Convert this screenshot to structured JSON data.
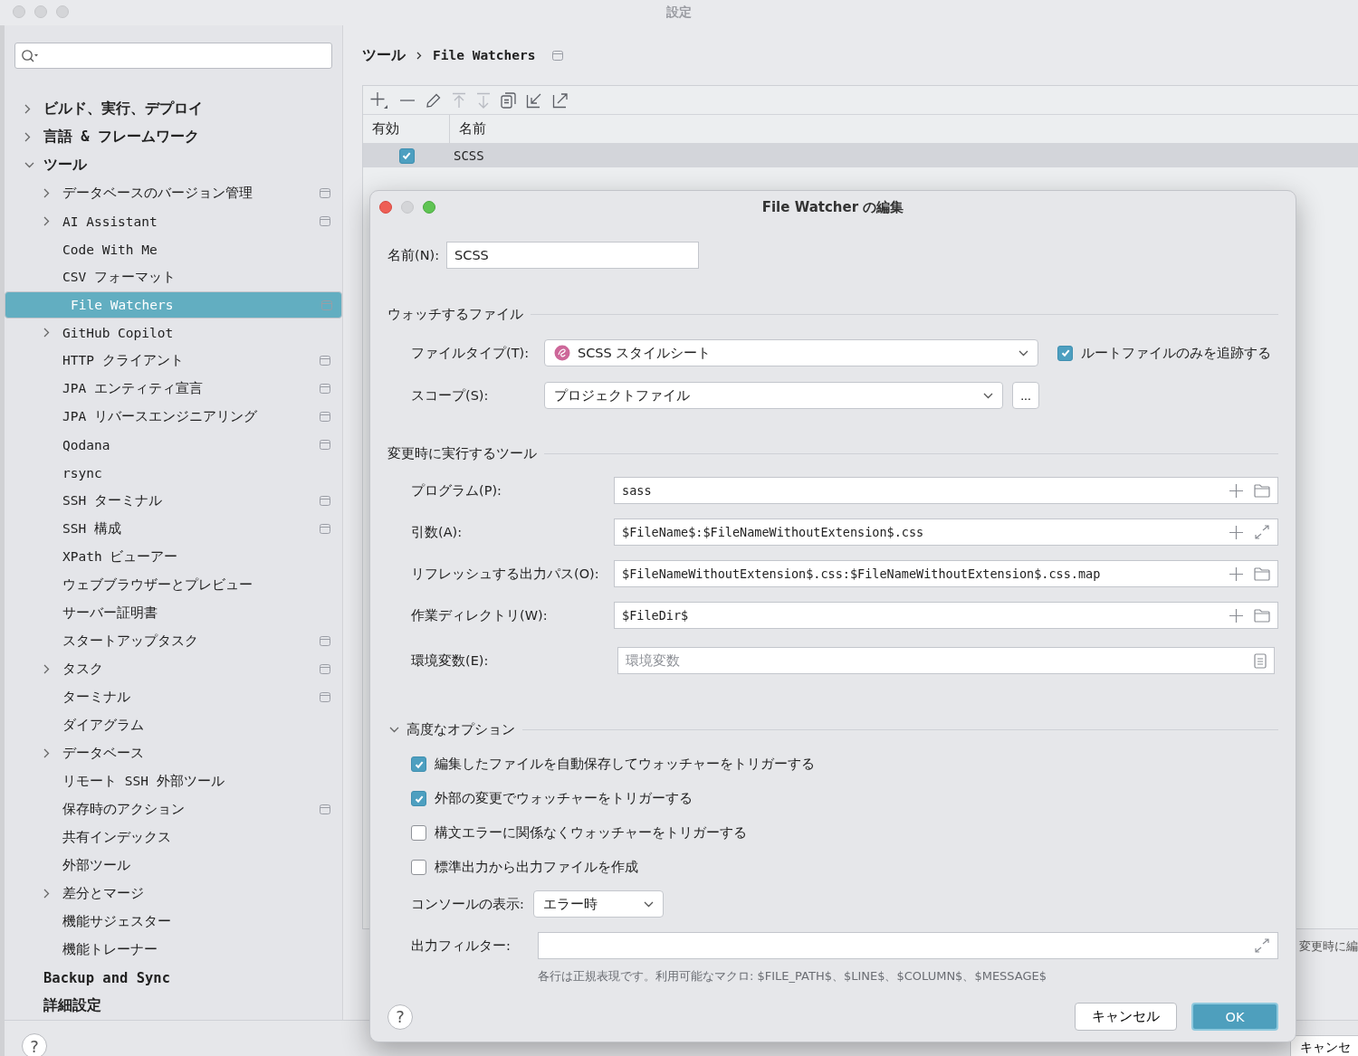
{
  "window": {
    "title": "設定",
    "help_button": "?"
  },
  "sidebar": {
    "items": [
      {
        "label": "ビルド、実行、デプロイ",
        "expanded": false,
        "selected": false
      },
      {
        "label": "言語 & フレームワーク",
        "expanded": false,
        "selected": false
      },
      {
        "label": "ツール",
        "expanded": true,
        "selected": false,
        "children": [
          {
            "label": "データベースのバージョン管理",
            "expanded": false,
            "selected": false,
            "project_level": true
          },
          {
            "label": "AI Assistant",
            "expanded": false,
            "selected": false,
            "project_level": true
          },
          {
            "label": "Code With Me",
            "selected": false,
            "project_level": false
          },
          {
            "label": "CSV フォーマット",
            "selected": false,
            "project_level": false
          },
          {
            "label": "File Watchers",
            "selected": true,
            "project_level": true
          },
          {
            "label": "GitHub Copilot",
            "expanded": false,
            "selected": false,
            "project_level": false
          },
          {
            "label": "HTTP クライアント",
            "selected": false,
            "project_level": true
          },
          {
            "label": "JPA エンティティ宣言",
            "selected": false,
            "project_level": true
          },
          {
            "label": "JPA リバースエンジニアリング",
            "selected": false,
            "project_level": true
          },
          {
            "label": "Qodana",
            "selected": false,
            "project_level": true
          },
          {
            "label": "rsync",
            "selected": false,
            "project_level": false
          },
          {
            "label": "SSH ターミナル",
            "selected": false,
            "project_level": true
          },
          {
            "label": "SSH 構成",
            "selected": false,
            "project_level": true
          },
          {
            "label": "XPath ビューアー",
            "selected": false,
            "project_level": false
          },
          {
            "label": "ウェブブラウザーとプレビュー",
            "selected": false,
            "project_level": false
          },
          {
            "label": "サーバー証明書",
            "selected": false,
            "project_level": false
          },
          {
            "label": "スタートアップタスク",
            "selected": false,
            "project_level": true
          },
          {
            "label": "タスク",
            "expanded": false,
            "selected": false,
            "project_level": true
          },
          {
            "label": "ターミナル",
            "selected": false,
            "project_level": true
          },
          {
            "label": "ダイアグラム",
            "selected": false,
            "project_level": false
          },
          {
            "label": "データベース",
            "expanded": false,
            "selected": false,
            "project_level": false
          },
          {
            "label": "リモート SSH 外部ツール",
            "selected": false,
            "project_level": false
          },
          {
            "label": "保存時のアクション",
            "selected": false,
            "project_level": true
          },
          {
            "label": "共有インデックス",
            "selected": false,
            "project_level": false
          },
          {
            "label": "外部ツール",
            "selected": false,
            "project_level": false
          },
          {
            "label": "差分とマージ",
            "expanded": false,
            "selected": false,
            "project_level": false
          },
          {
            "label": "機能サジェスター",
            "selected": false,
            "project_level": false
          },
          {
            "label": "機能トレーナー",
            "selected": false,
            "project_level": false
          }
        ]
      },
      {
        "label": "Backup and Sync",
        "selected": false
      },
      {
        "label": "詳細設定",
        "selected": false
      }
    ]
  },
  "header": {
    "breadcrumb": [
      "ツール",
      "File Watchers"
    ],
    "project_level": true
  },
  "toolbar": [
    {
      "kind": "add",
      "disabled": false
    },
    {
      "kind": "remove",
      "disabled": false
    },
    {
      "kind": "edit",
      "disabled": false
    },
    {
      "kind": "up",
      "disabled": true
    },
    {
      "kind": "down",
      "disabled": true
    },
    {
      "kind": "copy",
      "disabled": false
    },
    {
      "kind": "import",
      "disabled": false
    },
    {
      "kind": "export",
      "disabled": false
    }
  ],
  "table": {
    "columns": [
      "有効",
      "名前"
    ],
    "rows": [
      {
        "enabled": true,
        "name": "SCSS",
        "selected": true
      }
    ]
  },
  "behind_dialog": {
    "description_fragment": "変更時に編",
    "cancel_button": "キャンセ"
  },
  "dialog": {
    "title": "File Watcher の編集",
    "name_field": {
      "label": "名前(N):",
      "value": "SCSS"
    },
    "files_section": {
      "title": "ウォッチするファイル",
      "file_type": {
        "label": "ファイルタイプ(T):",
        "value": "SCSS スタイルシート"
      },
      "root_only": {
        "label": "ルートファイルのみを追跡する",
        "checked": true
      },
      "scope": {
        "label": "スコープ(S):",
        "value": "プロジェクトファイル",
        "more_button": "..."
      }
    },
    "tool_section": {
      "title": "変更時に実行するツール",
      "fields": [
        {
          "label": "プログラム(P):",
          "value": "sass",
          "kind": "browse"
        },
        {
          "label": "引数(A):",
          "value": "$FileName$:$FileNameWithoutExtension$.css",
          "kind": "expand"
        },
        {
          "label": "リフレッシュする出力パス(O):",
          "value": "$FileNameWithoutExtension$.css:$FileNameWithoutExtension$.css.map",
          "kind": "browse"
        },
        {
          "label": "作業ディレクトリ(W):",
          "value": "$FileDir$",
          "kind": "browse"
        }
      ],
      "env": {
        "label": "環境変数(E):",
        "placeholder": "環境変数"
      }
    },
    "advanced": {
      "title": "高度なオプション",
      "expanded": true,
      "options": [
        {
          "label": "編集したファイルを自動保存してウォッチャーをトリガーする",
          "checked": true
        },
        {
          "label": "外部の変更でウォッチャーをトリガーする",
          "checked": true
        },
        {
          "label": "構文エラーに関係なくウォッチャーをトリガーする",
          "checked": false
        },
        {
          "label": "標準出力から出力ファイルを作成",
          "checked": false
        }
      ],
      "console": {
        "label": "コンソールの表示:",
        "value": "エラー時"
      },
      "output_filter": {
        "label": "出力フィルター:"
      },
      "hint": "各行は正規表現です。利用可能なマクロ: $FILE_PATH$、$LINE$、$COLUMN$、$MESSAGE$"
    },
    "help_button": "?",
    "cancel_button": "キャンセル",
    "ok_button": "OK"
  }
}
